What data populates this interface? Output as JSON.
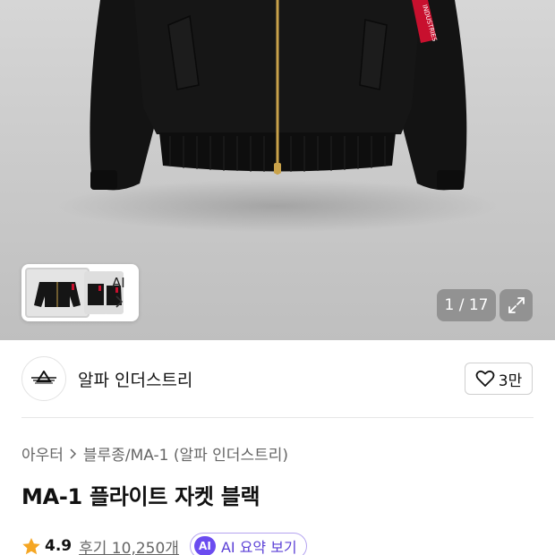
{
  "gallery": {
    "thumbnail_ai_label": "AI",
    "counter": "1 / 17"
  },
  "brand": {
    "name": "알파 인더스트리",
    "likes": "3만"
  },
  "breadcrumb": {
    "category": "아우터",
    "subcategory": "블루종/MA-1 (알파 인더스트리)"
  },
  "product": {
    "title": "MA-1 플라이트 자켓 블랙",
    "rating": "4.9",
    "reviews": "후기 10,250개"
  },
  "ai_summary": {
    "badge": "AI",
    "label": "AI 요약 보기"
  },
  "jacket_tag_text": "INDUSTRIES",
  "colors": {
    "star": "#f5a623",
    "ai_accent": "#6b4cf0",
    "jacket": "#151515",
    "zipper": "#c9a24a",
    "tag": "#c8102e"
  }
}
